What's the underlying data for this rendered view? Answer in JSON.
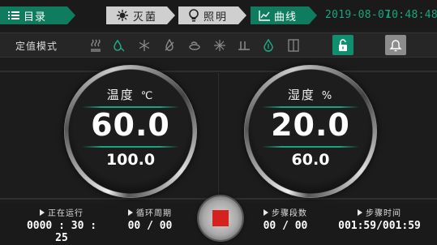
{
  "topbar": {
    "menu_label": "目录",
    "sterilize_label": "灭菌",
    "lighting_label": "照明",
    "curve_label": "曲线",
    "date": "2019-08-07",
    "time": "10:48:48"
  },
  "modebar": {
    "label": "定值模式",
    "icons": [
      "heater-icon",
      "humidify-icon",
      "cool-icon",
      "dehumidify-icon",
      "fan-icon",
      "defrost-icon",
      "water-icon",
      "drop-icon",
      "door-icon"
    ]
  },
  "temperature": {
    "title": "温度",
    "unit": "℃",
    "value": "60.0",
    "setpoint": "100.0"
  },
  "humidity": {
    "title": "湿度",
    "unit": "%",
    "value": "20.0",
    "setpoint": "60.0"
  },
  "status": {
    "running_label": "正在运行",
    "running_value": "0000 : 30 : 25",
    "cycle_label": "循环周期",
    "cycle_value": "00 / 00",
    "step_label": "步骤段数",
    "step_value": "00 / 00",
    "step_time_label": "步骤时间",
    "step_time_value": "001:59/001:59"
  },
  "colors": {
    "accent": "#0f7c60",
    "accent_bright": "#16a57f",
    "stop": "#d4231e"
  }
}
